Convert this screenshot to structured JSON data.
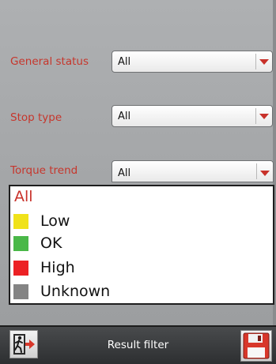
{
  "filters": {
    "general_status": {
      "label": "General status",
      "value": "All"
    },
    "stop_type": {
      "label": "Stop type",
      "value": "All"
    },
    "torque_trend": {
      "label": "Torque trend",
      "value": "All"
    }
  },
  "dropdown": {
    "selected": "All",
    "options": [
      {
        "label": "Low",
        "color": "#f0e21a"
      },
      {
        "label": "OK",
        "color": "#4ab848"
      },
      {
        "label": "High",
        "color": "#ec2124"
      },
      {
        "label": "Unknown",
        "color": "#848484"
      }
    ]
  },
  "bottombar": {
    "title": "Result filter",
    "exit_icon": "exit-door-icon",
    "save_icon": "floppy-disk-icon"
  },
  "colors": {
    "label_red": "#c6362c",
    "arrow_red": "#c8312a"
  }
}
